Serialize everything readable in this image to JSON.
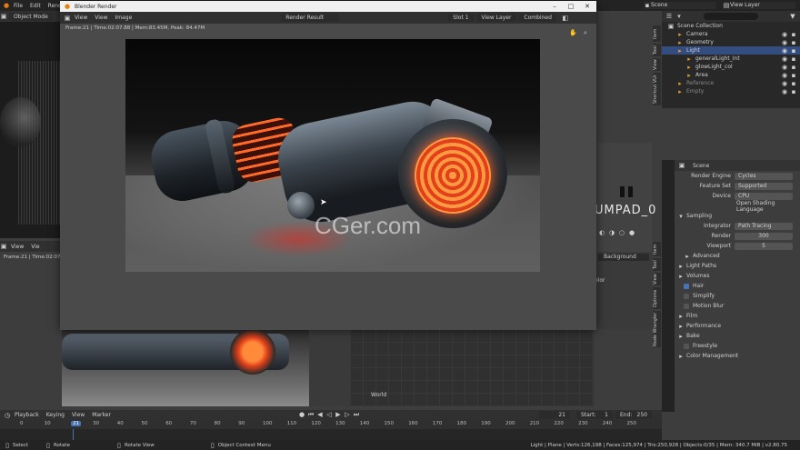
{
  "topbar": {
    "menus": [
      "File",
      "Edit",
      "Render"
    ],
    "mode": "Object Mode",
    "scene": "Scene",
    "view_layer": "View Layer"
  },
  "left_vp": {
    "header2": [
      "View",
      "Vie"
    ],
    "status": "Frame:21 | Time:02:07.88"
  },
  "render_win": {
    "title": "Blender Render",
    "menus": [
      "View",
      "View",
      "Image"
    ],
    "image_name": "Render Result",
    "slot": "Slot 1",
    "view_layer": "View Layer",
    "pass": "Combined",
    "status": "Frame:21 | Time:02:07.88 | Mem:83.45M, Peak: 84.47M",
    "watermark": "CGer.com"
  },
  "middle": {
    "text_fragment": "UMPAD_0",
    "world_label": "World",
    "shortcut_tab": "Shortcut VUr",
    "bg_label": "Background",
    "olor_label": "olor"
  },
  "outliner": {
    "items": [
      {
        "label": "Scene Collection",
        "indent": 0
      },
      {
        "label": "Camera",
        "indent": 1
      },
      {
        "label": "Geometry",
        "indent": 1
      },
      {
        "label": "Light",
        "indent": 1
      },
      {
        "label": "generalLight_Int",
        "indent": 2
      },
      {
        "label": "glowLight_col",
        "indent": 2
      },
      {
        "label": "Area",
        "indent": 2
      },
      {
        "label": "Reference",
        "indent": 1
      },
      {
        "label": "Empty",
        "indent": 1
      }
    ],
    "tabs": [
      "Item",
      "Tool",
      "View",
      "Shortcut VUr"
    ]
  },
  "properties": {
    "scene": "Scene",
    "render_engine_label": "Render Engine",
    "render_engine": "Cycles",
    "feature_set_label": "Feature Set",
    "feature_set": "Supported",
    "device_label": "Device",
    "device": "CPU",
    "osl": "Open Shading Language",
    "sampling": "Sampling",
    "integrator_label": "Integrator",
    "integrator": "Path Tracing",
    "render_label": "Render",
    "render_samples": "300",
    "viewport_label": "Viewport",
    "viewport_samples": "5",
    "advanced": "Advanced",
    "light_paths": "Light Paths",
    "volumes": "Volumes",
    "hair": "Hair",
    "simplify": "Simplify",
    "motion_blur": "Motion Blur",
    "film": "Film",
    "performance": "Performance",
    "bake": "Bake",
    "freestyle": "Freestyle",
    "color_management": "Color Management",
    "side_tabs": [
      "Item",
      "Tool",
      "View",
      "Options",
      "Node Wrangler"
    ]
  },
  "timeline": {
    "menus": [
      "Playback",
      "Keying",
      "View",
      "Marker"
    ],
    "current_frame": "21",
    "start_label": "Start:",
    "start": "1",
    "end_label": "End:",
    "end": "250",
    "ticks": [
      "0",
      "10",
      "21",
      "30",
      "40",
      "50",
      "60",
      "70",
      "80",
      "90",
      "100",
      "110",
      "120",
      "130",
      "140",
      "150",
      "160",
      "170",
      "180",
      "190",
      "200",
      "210",
      "220",
      "230",
      "240",
      "250"
    ]
  },
  "statusbar": {
    "select": "Select",
    "rotate": "Rotate",
    "rotate_view": "Rotate View",
    "context_menu": "Object Context Menu",
    "info": "Light | Plane | Verts:126,198 | Faces:125,974 | Tris:250,928 | Objects:0/35 | Mem: 340.7 MiB | v2.80.75"
  },
  "colors": {
    "accent": "#4772b3",
    "glow": "#ff5a1e",
    "panel": "#3d3d3d",
    "header": "#232323"
  }
}
